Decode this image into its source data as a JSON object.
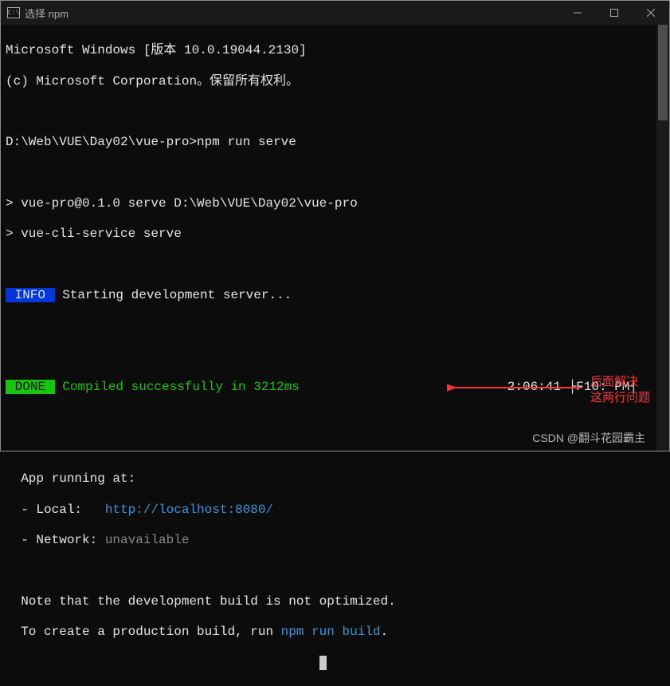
{
  "titlebar": {
    "icon_glyph": "C:\\",
    "title": "选择 npm"
  },
  "lines": {
    "l1": "Microsoft Windows [版本 10.0.19044.2130]",
    "l2": "(c) Microsoft Corporation。保留所有权利。",
    "l3": "",
    "prompt": "D:\\Web\\VUE\\Day02\\vue-pro>",
    "cmd": "npm run serve",
    "l5": "",
    "l6": "> vue-pro@0.1.0 serve D:\\Web\\VUE\\Day02\\vue-pro",
    "l7": "> vue-cli-service serve",
    "l8": "",
    "info_badge": " INFO ",
    "info_text": " Starting development server...",
    "l10": "",
    "l11": "",
    "done_badge": " DONE ",
    "done_text": " Compiled successfully in 3212ms",
    "done_time": "2:06:41 ├F10: PM┤",
    "l13": "",
    "l14": "",
    "app1": "  App running at:",
    "app2_label": "  - Local:   ",
    "app2_url": "http://localhost:8080/",
    "app3_label": "  - Network: ",
    "app3_val": "unavailable",
    "l18": "",
    "note1": "  Note that the development build is not optimized.",
    "note2_a": "  To create a production build, run ",
    "note2_b": "npm run build",
    "note2_c": "."
  },
  "annotation": {
    "text1": "后面解决",
    "text2": "这两行问题"
  },
  "watermark": "CSDN @翻斗花园霸主"
}
